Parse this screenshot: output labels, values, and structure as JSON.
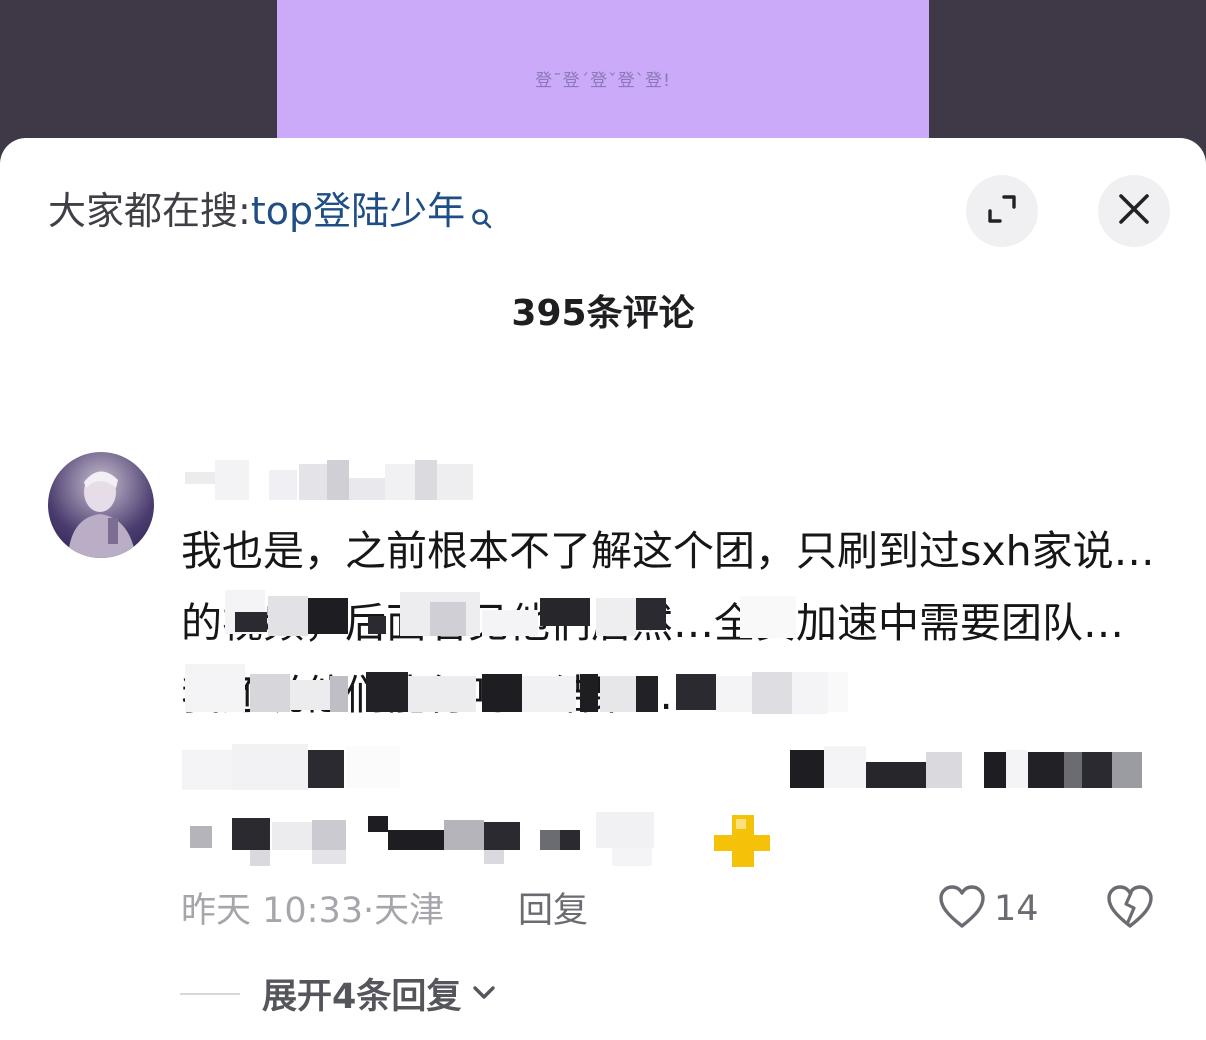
{
  "video": {
    "caption": "登¯登´登ˇ登ˋ登!"
  },
  "search": {
    "prefix": "大家都在搜:",
    "keyword": "top登陆少年"
  },
  "header": {
    "comment_count": "395条评论"
  },
  "comment": {
    "text": "我也是，之前根本不了解这个团，只刷到过sxh家说…的视频，后面看见他们居然…全员加速中需要团队…我还说他们能行吗？结果…",
    "timestamp": "昨天 10:33",
    "separator": "·",
    "location": "天津",
    "reply_label": "回复",
    "like_count": "14",
    "expand_replies_label": "展开4条回复"
  },
  "icons": {
    "search": "search-icon",
    "expand": "expand-icon",
    "close": "close-icon",
    "like": "heart-outline-icon",
    "dislike": "broken-heart-icon",
    "chevron": "chevron-down-icon"
  },
  "colors": {
    "video_frame": "#caaaf9",
    "video_bg": "#3f3947",
    "search_keyword": "#1f4e86",
    "meta_text": "#a5a5ab"
  }
}
